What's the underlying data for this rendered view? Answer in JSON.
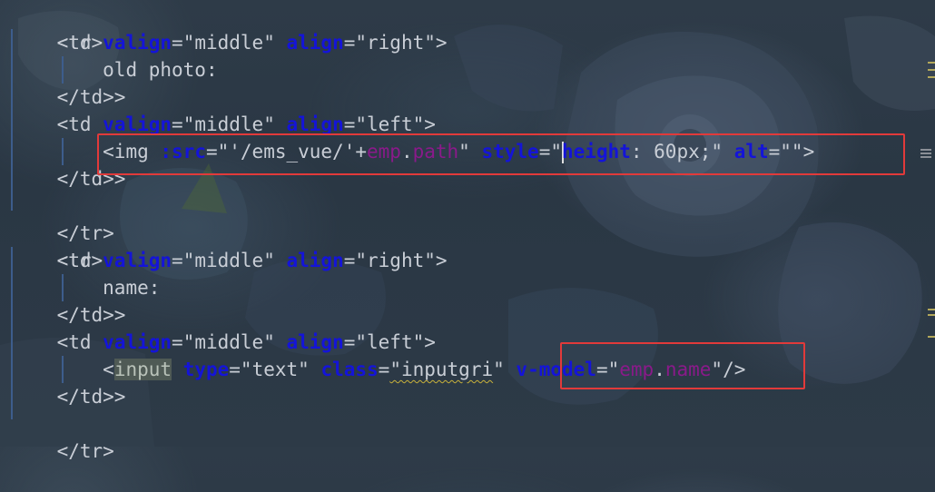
{
  "editor": {
    "language": "vue-template",
    "lines": [
      {
        "indent": 0,
        "text": "<tr>"
      },
      {
        "indent": 1,
        "text": "<td valign=\"middle\" align=\"right\">"
      },
      {
        "indent": 2,
        "text": "old photo:"
      },
      {
        "indent": 1,
        "text": "</td>"
      },
      {
        "indent": 1,
        "text": "<td valign=\"middle\" align=\"left\">"
      },
      {
        "indent": 2,
        "text": "<img :src=\"'/ems_vue/'+emp.path\" style=\"height: 60px;\" alt=\"\">"
      },
      {
        "indent": 1,
        "text": "</td>"
      },
      {
        "indent": 0,
        "text": "</tr>"
      },
      {
        "indent": 0,
        "text": "<tr>"
      },
      {
        "indent": 1,
        "text": "<td valign=\"middle\" align=\"right\">"
      },
      {
        "indent": 2,
        "text": "name:"
      },
      {
        "indent": 1,
        "text": "</td>"
      },
      {
        "indent": 1,
        "text": "<td valign=\"middle\" align=\"left\">"
      },
      {
        "indent": 2,
        "text": "<input type=\"text\" class=\"inputgri\" v-model=\"emp.name\"/>"
      },
      {
        "indent": 1,
        "text": "</td>"
      },
      {
        "indent": 0,
        "text": "</tr>"
      }
    ],
    "tokens": {
      "tr_open": "<tr>",
      "tr_close": "</tr>",
      "td_open": "<td",
      "td_close": "</td>",
      "gt": ">",
      "valign": "valign",
      "align": "align",
      "middle": "\"middle\"",
      "right": "\"right\"",
      "left": "\"left\"",
      "old_photo": "old photo:",
      "name_label": "name:",
      "img_open": "<img",
      "src_attr": ":src",
      "src_quote_open": "\"'/ems_vue/'+",
      "emp": "emp",
      "path": "path",
      "quote_close": "\"",
      "style_attr": "style",
      "height_prop": "height",
      "style_value": ": 60px;\"",
      "alt_attr": "alt",
      "empty_str": "\"\"",
      "input_open": "input",
      "lt": "<",
      "type_attr": "type",
      "text_val": "\"text\"",
      "class_attr": "class",
      "class_val_open": "\"inputgri",
      "vmodel_attr": "v-model",
      "name_prop": "name",
      "self_close": "/>",
      "eq": "=",
      "quote_open": "\"",
      "dot": "."
    }
  },
  "highlights": {
    "color": "#e23a3a",
    "boxes": [
      "img-line-highlight",
      "v-model-highlight"
    ]
  },
  "colors": {
    "attribute": "#1414d8",
    "expression": "#8a1a8a",
    "text": "#c9ced6",
    "guide": "#3d5d8c",
    "background": "#2b3845"
  }
}
